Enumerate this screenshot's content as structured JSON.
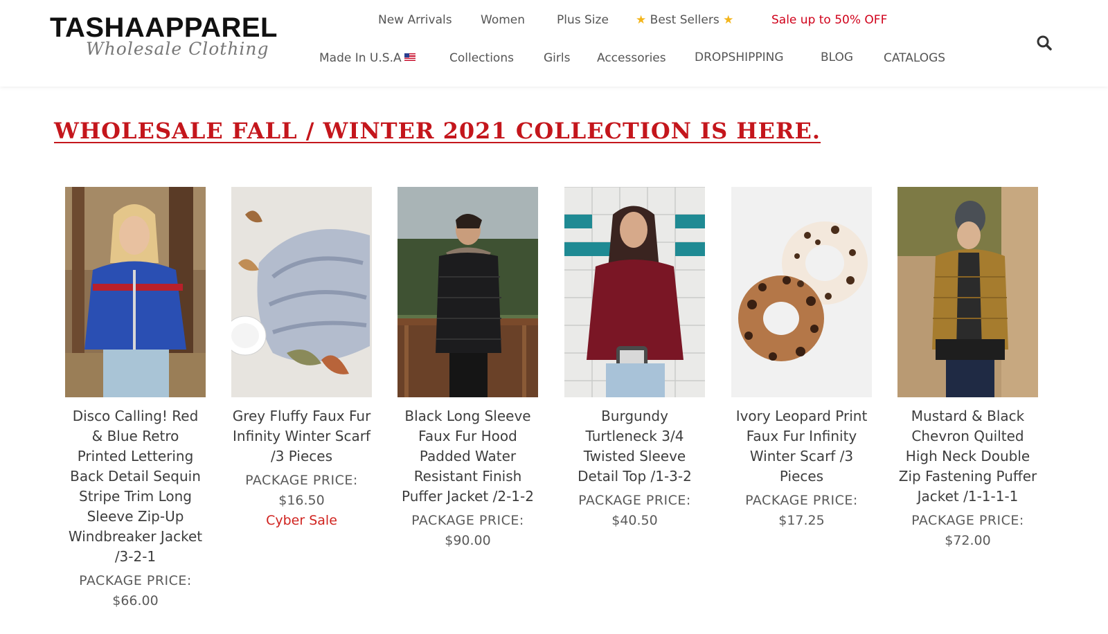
{
  "brand": {
    "name": "TASHAAPPAREL",
    "tagline": "Wholesale Clothing"
  },
  "nav": {
    "row1": [
      {
        "label": "New Arrivals"
      },
      {
        "label": "Women"
      },
      {
        "label": "Plus Size"
      },
      {
        "label": "Best Sellers"
      },
      {
        "label": "Sale up to 50% OFF"
      }
    ],
    "row2": [
      {
        "label": "Made In U.S.A"
      },
      {
        "label": "Collections"
      },
      {
        "label": "Girls"
      },
      {
        "label": "Accessories"
      },
      {
        "label": "DROPSHIPPING"
      },
      {
        "label": "BLOG"
      },
      {
        "label": "CATALOGS"
      }
    ]
  },
  "headline": "Wholesale Fall / Winter 2021 Collection is Here.",
  "price_label": "PACKAGE PRICE:",
  "products": [
    {
      "name": "Disco Calling! Red & Blue Retro Printed Lettering Back Detail Sequin Stripe Trim Long Sleeve Zip-Up Windbreaker Jacket /3-2-1",
      "price": "$66.00",
      "tag": ""
    },
    {
      "name": "Grey Fluffy Faux Fur Infinity Winter Scarf /3 Pieces",
      "price": "$16.50",
      "tag": "Cyber Sale"
    },
    {
      "name": "Black Long Sleeve Faux Fur Hood Padded Water Resistant Finish Puffer Jacket /2-1-2",
      "price": "$90.00",
      "tag": ""
    },
    {
      "name": "Burgundy Turtleneck 3/4 Twisted Sleeve Detail Top /1-3-2",
      "price": "$40.50",
      "tag": ""
    },
    {
      "name": "Ivory Leopard Print Faux Fur Infinity Winter Scarf /3 Pieces",
      "price": "$17.25",
      "tag": ""
    },
    {
      "name": "Mustard & Black Chevron Quilted High Neck Double Zip Fastening Puffer Jacket /1-1-1-1",
      "price": "$72.00",
      "tag": ""
    }
  ],
  "colors": {
    "accent_red": "#c4161c",
    "sale_red": "#d0021b",
    "text": "#3d3d3d"
  }
}
